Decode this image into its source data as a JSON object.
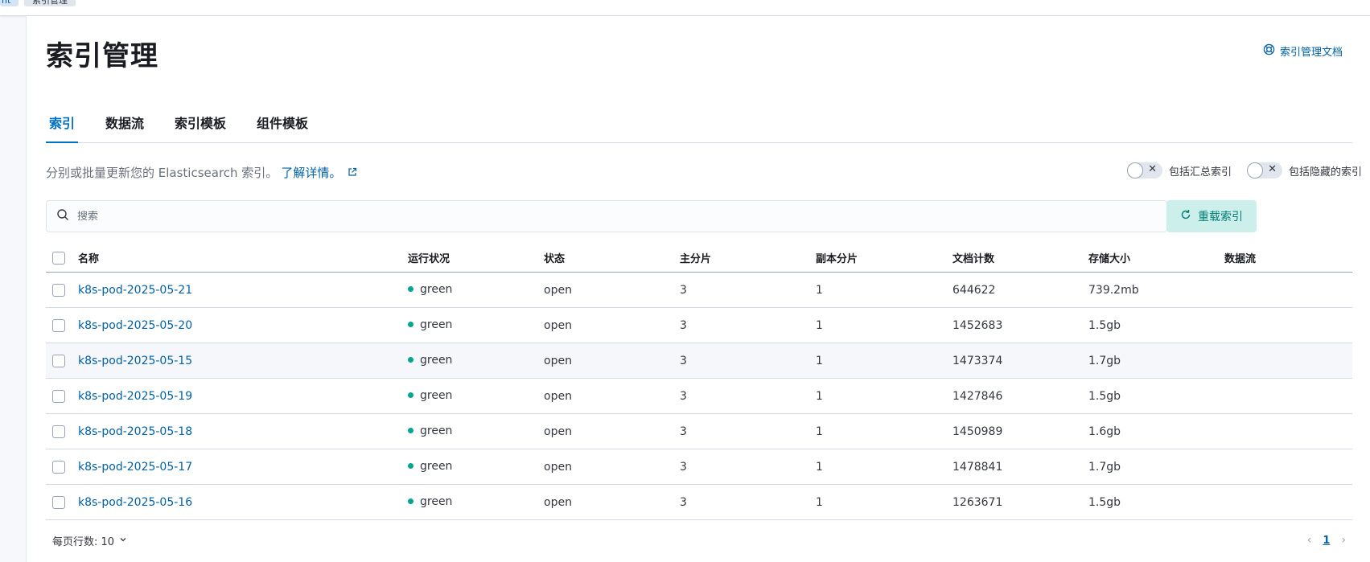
{
  "breadcrumbs": [
    "nt",
    "索引管理"
  ],
  "page": {
    "title": "索引管理",
    "doc_link": "索引管理文档"
  },
  "tabs": [
    {
      "label": "索引",
      "active": true
    },
    {
      "label": "数据流",
      "active": false
    },
    {
      "label": "索引模板",
      "active": false
    },
    {
      "label": "组件模板",
      "active": false
    }
  ],
  "description": {
    "text": "分别或批量更新您的 Elasticsearch 索引。",
    "link": "了解详情。"
  },
  "toggles": {
    "rollup": {
      "label": "包括汇总索引",
      "on": false
    },
    "hidden": {
      "label": "包括隐藏的索引",
      "on": false
    }
  },
  "search": {
    "placeholder": "搜索",
    "value": ""
  },
  "reload_button": "重载索引",
  "table": {
    "columns": [
      "名称",
      "运行状况",
      "状态",
      "主分片",
      "副本分片",
      "文档计数",
      "存储大小",
      "数据流"
    ],
    "rows": [
      {
        "name": "k8s-pod-2025-05-21",
        "health": "green",
        "status": "open",
        "primary": "3",
        "replica": "1",
        "docs": "644622",
        "size": "739.2mb",
        "data_stream": ""
      },
      {
        "name": "k8s-pod-2025-05-20",
        "health": "green",
        "status": "open",
        "primary": "3",
        "replica": "1",
        "docs": "1452683",
        "size": "1.5gb",
        "data_stream": ""
      },
      {
        "name": "k8s-pod-2025-05-15",
        "health": "green",
        "status": "open",
        "primary": "3",
        "replica": "1",
        "docs": "1473374",
        "size": "1.7gb",
        "data_stream": ""
      },
      {
        "name": "k8s-pod-2025-05-19",
        "health": "green",
        "status": "open",
        "primary": "3",
        "replica": "1",
        "docs": "1427846",
        "size": "1.5gb",
        "data_stream": ""
      },
      {
        "name": "k8s-pod-2025-05-18",
        "health": "green",
        "status": "open",
        "primary": "3",
        "replica": "1",
        "docs": "1450989",
        "size": "1.6gb",
        "data_stream": ""
      },
      {
        "name": "k8s-pod-2025-05-17",
        "health": "green",
        "status": "open",
        "primary": "3",
        "replica": "1",
        "docs": "1478841",
        "size": "1.7gb",
        "data_stream": ""
      },
      {
        "name": "k8s-pod-2025-05-16",
        "health": "green",
        "status": "open",
        "primary": "3",
        "replica": "1",
        "docs": "1263671",
        "size": "1.5gb",
        "data_stream": ""
      }
    ]
  },
  "footer": {
    "rows_per_page": "每页行数: 10",
    "current_page": "1"
  },
  "colors": {
    "accent": "#0071c2",
    "link": "#0061a6",
    "health_green": "#00a690",
    "reload_bg": "#cdefec",
    "reload_text": "#017d73"
  },
  "icons": {
    "doc_link": "help-lifebuoy-icon",
    "external": "external-link-icon",
    "search": "search-icon",
    "reload": "refresh-icon",
    "chevron": "chevron-down-icon"
  }
}
